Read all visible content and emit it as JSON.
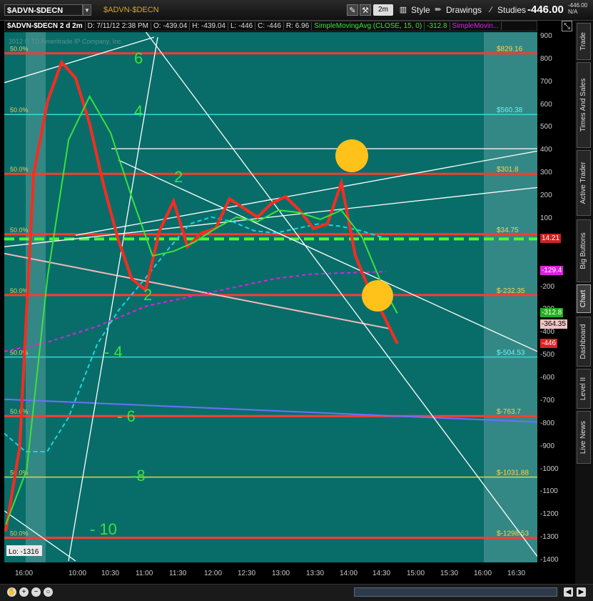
{
  "window": {
    "symbol": "$ADVN-$DECN",
    "symbol_title": "$ADVN-$DECN",
    "aggregation": "2m",
    "style_label": "Style",
    "drawings_label": "Drawings",
    "studies_label": "Studies",
    "last_price": "-446.00",
    "last_small_1": "-446.00",
    "last_small_2": "N/A"
  },
  "infobar": {
    "desc": "$ADVN-$DECN 2 d 2m",
    "date": "D: 7/11/12 2:38 PM",
    "open": "O: -439.04",
    "high": "H: -439.04",
    "low": "L: -446",
    "close": "C: -446",
    "range": "R: 6.96",
    "study": "SimpleMovingAvg (CLOSE, 15, 0)",
    "study_value": "-312.8",
    "study2": "SimpleMovin..."
  },
  "watermark": "2012 © TD Ameritrade IP Company, Inc.",
  "chart_data": {
    "type": "line",
    "title": "$ADVN-$DECN 2 d 2m",
    "ylim": [
      -1400,
      900
    ],
    "yticks": [
      900,
      800,
      700,
      600,
      500,
      400,
      300,
      200,
      100,
      -200,
      -300,
      -400,
      -500,
      -600,
      -700,
      -800,
      -900,
      -1000,
      -1100,
      -1200,
      -1300,
      -1400
    ],
    "xticks": [
      "16:00",
      "10:00",
      "10:30",
      "11:00",
      "11:30",
      "12:00",
      "12:30",
      "13:00",
      "13:30",
      "14:00",
      "14:30",
      "15:00",
      "15:30",
      "16:00",
      "16:30"
    ],
    "fib_levels": [
      {
        "pct": "50.0%",
        "value": 829.16,
        "label": "$829.16",
        "color": "#ff3b2e"
      },
      {
        "pct": "50.0%",
        "value": 560.38,
        "label": "$560.38",
        "color": "#36d8d8"
      },
      {
        "pct": "50.0%",
        "value": 300,
        "label": "$301.8",
        "color": "#ff3b2e"
      },
      {
        "pct": "50.0%",
        "value": 34.75,
        "label": "$34.75",
        "color": "#ff3b2e"
      },
      {
        "pct": "50.0%",
        "value": -232.35,
        "label": "$-232.35",
        "color": "#ff3b2e"
      },
      {
        "pct": "50.0%",
        "value": -504.53,
        "label": "$-504.53",
        "color": "#36d8d8"
      },
      {
        "pct": "50.0%",
        "value": -763.7,
        "label": "$-763.7",
        "color": "#ff3b2e"
      },
      {
        "pct": "50.0%",
        "value": -1031.88,
        "label": "$-1031.88",
        "color": "#d8d84a"
      },
      {
        "pct": "50.0%",
        "value": -1298.53,
        "label": "$-1298.53",
        "color": "#ff3b2e"
      }
    ],
    "counts": [
      "6",
      "4",
      "2",
      "2",
      "- 4",
      "- 6",
      "-8",
      "- 10"
    ],
    "low_label": "Lo: -1316",
    "series": [
      {
        "name": "$ADVN-$DECN",
        "color": "#ff2a1f",
        "x": [
          0,
          4,
          8,
          12,
          16,
          20,
          24,
          28,
          32,
          36,
          40,
          44,
          48,
          52,
          56,
          60,
          64,
          68,
          72,
          76,
          80,
          84,
          88,
          92,
          96,
          100,
          104,
          108,
          112
        ],
        "values": [
          -1270,
          -900,
          300,
          620,
          790,
          720,
          520,
          250,
          20,
          -160,
          -210,
          50,
          180,
          -20,
          40,
          60,
          190,
          150,
          110,
          170,
          200,
          140,
          60,
          80,
          260,
          -60,
          -210,
          -320,
          -446
        ]
      },
      {
        "name": "SimpleMovingAvg (CLOSE, 15, 0)",
        "color": "#3ce03c",
        "x": [
          0,
          6,
          12,
          18,
          24,
          30,
          36,
          42,
          48,
          54,
          60,
          66,
          72,
          78,
          84,
          90,
          96,
          102,
          108,
          112
        ],
        "values": [
          -1240,
          -1000,
          -150,
          450,
          640,
          480,
          200,
          -60,
          -40,
          0,
          60,
          110,
          90,
          140,
          130,
          100,
          140,
          20,
          -200,
          -312.8
        ]
      }
    ],
    "badges": [
      {
        "value": "14.21",
        "bg": "#cc2222",
        "fg": "#fff"
      },
      {
        "value": "-129.4",
        "bg": "#e21ee2",
        "fg": "#fff"
      },
      {
        "value": "-312.8",
        "bg": "#20b020",
        "fg": "#fff"
      },
      {
        "value": "-364.35",
        "bg": "#f1c4c4",
        "fg": "#000"
      },
      {
        "value": "-446",
        "bg": "#e02020",
        "fg": "#fff"
      }
    ]
  },
  "side_tabs": [
    "Trade",
    "Times And Sales",
    "Active Trader",
    "Big Buttons",
    "Chart",
    "Dashboard",
    "Level II",
    "Live News"
  ],
  "icons": {
    "drawing": "pencil-icon",
    "gear": "wrench-icon",
    "style": "bars-icon",
    "close": "zoom-icon"
  }
}
